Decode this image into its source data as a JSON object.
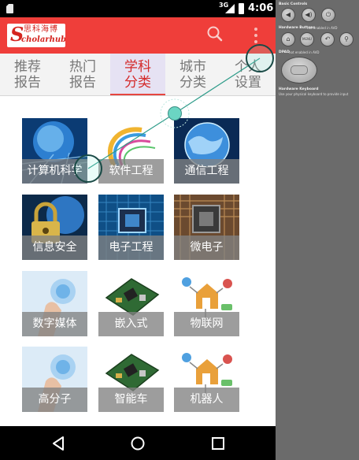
{
  "status_bar": {
    "network": "3G",
    "time": "4:06"
  },
  "header": {
    "logo_char": "S",
    "logo_cn": "思科海博",
    "logo_en": "cholarhub",
    "search_icon": "search-icon",
    "menu_icon": "overflow-menu-icon"
  },
  "tabs": [
    {
      "label": "推荐\n报告",
      "active": false
    },
    {
      "label": "热门\n报告",
      "active": false
    },
    {
      "label": "学科\n分类",
      "active": true
    },
    {
      "label": "城市\n分类",
      "active": false
    },
    {
      "label": "个人\n设置",
      "active": false
    }
  ],
  "categories": [
    {
      "label": "计算机科学",
      "image": "blue-earth-circuit"
    },
    {
      "label": "软件工程",
      "image": "swirl-rainbow"
    },
    {
      "label": "通信工程",
      "image": "blue-globe"
    },
    {
      "label": "信息安全",
      "image": "padlock-globe"
    },
    {
      "label": "电子工程",
      "image": "blue-chip"
    },
    {
      "label": "微电子",
      "image": "microchip-board"
    },
    {
      "label": "数字媒体",
      "image": "hand-hologram"
    },
    {
      "label": "嵌入式",
      "image": "green-board"
    },
    {
      "label": "物联网",
      "image": "iot-house"
    },
    {
      "label": "高分子",
      "image": "hand-hologram"
    },
    {
      "label": "智能车",
      "image": "green-board"
    },
    {
      "label": "机器人",
      "image": "iot-house"
    }
  ],
  "nav_bar": {
    "back_icon": "back-icon",
    "home_icon": "home-icon",
    "recents_icon": "recents-icon"
  },
  "emulator": {
    "basic_controls_title": "Basic Controls",
    "hardware_buttons_title": "Hardware Buttons",
    "hardware_buttons_note": "not enabled in AVD",
    "menu_button_label": "MENU",
    "dpad_title": "DPAD",
    "dpad_note": "not enabled in AVD",
    "keyboard_title": "Hardware Keyboard",
    "keyboard_note": "Use your physical keyboard to provide input"
  },
  "colors": {
    "header_red": "#ef3e3a",
    "active_tab_text": "#d42a2a",
    "active_tab_bg": "#e6e2f3",
    "touch_marker": "#6bd5c3"
  }
}
